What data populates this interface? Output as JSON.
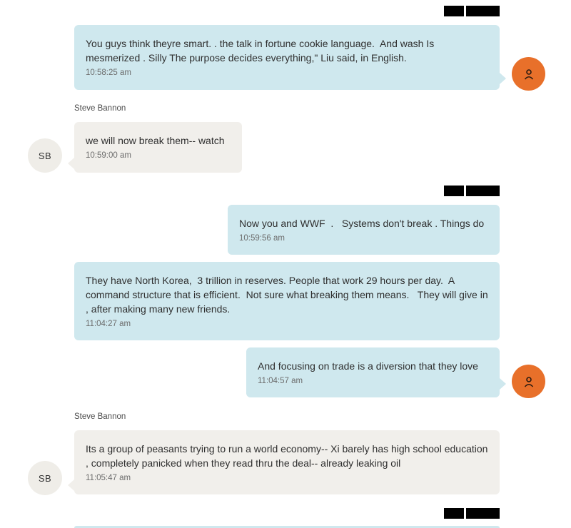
{
  "messages": [
    {
      "text": "You guys think theyre smart. . the talk in fortune cookie language.  And wash Is mesmerized . Silly The purpose decides everything,\" Liu said, in English.",
      "time": "10:58:25 am"
    },
    {
      "sender": "Steve Bannon",
      "avatar_initials": "SB",
      "text": "we will now break them-- watch",
      "time": "10:59:00 am"
    },
    {
      "text": "Now you and WWF  .   Systems don't break . Things do",
      "time": "10:59:56 am"
    },
    {
      "text": "They have North Korea,  3 trillion in reserves. People that work 29 hours per day.  A command structure that is efficient.  Not sure what breaking them means.   They will give in , after making many new friends.",
      "time": "11:04:27 am"
    },
    {
      "text": "And focusing on trade is a diversion that they love",
      "time": "11:04:57 am"
    },
    {
      "sender": "Steve Bannon",
      "avatar_initials": "SB",
      "text": "Its a group of peasants trying to run a world economy-- Xi barely has high school education , completely panicked when they read thru the deal-- already leaking oil",
      "time": "11:05:47 am"
    }
  ],
  "colors": {
    "outgoing_bubble": "#cfe8ee",
    "incoming_bubble": "#f1efeb",
    "avatar_me": "#e8702a",
    "redaction": "#000000"
  },
  "icons": {
    "me_avatar": "person-icon"
  }
}
